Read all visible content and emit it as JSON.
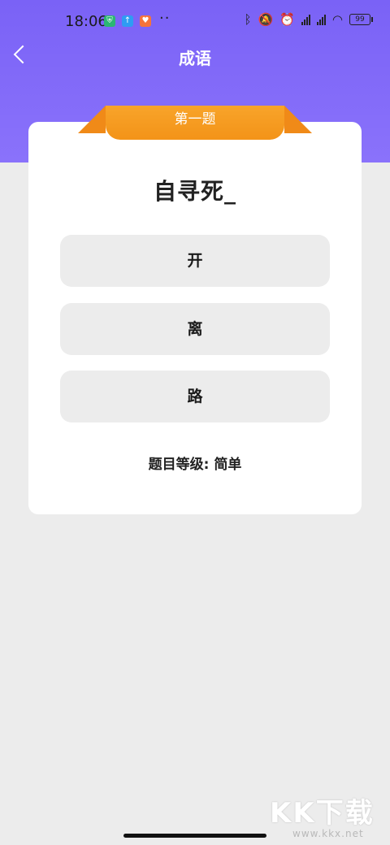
{
  "status_bar": {
    "time": "18:06",
    "battery": "99",
    "more": "··",
    "notification_icons": [
      {
        "name": "shield-app-icon",
        "color": "#2bb673",
        "glyph": "⛨"
      },
      {
        "name": "upload-app-icon",
        "color": "#2e9cf3",
        "glyph": "↑"
      },
      {
        "name": "orange-app-icon",
        "color": "#f5733a",
        "glyph": "♥"
      }
    ],
    "system_icons": [
      "bluetooth-icon",
      "mute-icon",
      "alarm-icon",
      "hd-signal-icon",
      "hd-signal-icon",
      "wifi-icon",
      "battery-icon"
    ],
    "hd_label": "HD"
  },
  "nav": {
    "title": "成语"
  },
  "quiz": {
    "ribbon_label": "第一题",
    "question": "自寻死_",
    "options": [
      "开",
      "离",
      "路"
    ],
    "level_text": "题目等级: 简单"
  },
  "colors": {
    "header": "#7a62f6",
    "ribbon": "#f39318",
    "option_bg": "#ececec"
  },
  "watermark": {
    "logo": "KK下载",
    "url": "www.kkx.net"
  }
}
